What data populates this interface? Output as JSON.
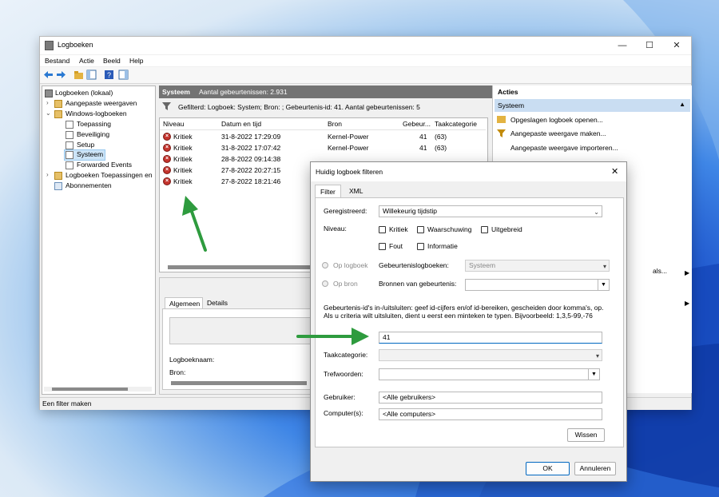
{
  "window": {
    "title": "Logboeken",
    "controls": {
      "minimize": "—",
      "maximize": "☐",
      "close": "✕"
    }
  },
  "menu": [
    "Bestand",
    "Actie",
    "Beeld",
    "Help"
  ],
  "tree": {
    "items": [
      {
        "label": "Logboeken (lokaal)"
      },
      {
        "label": "Aangepaste weergaven"
      },
      {
        "label": "Windows-logboeken"
      },
      {
        "label": "Toepassing"
      },
      {
        "label": "Beveiliging"
      },
      {
        "label": "Setup"
      },
      {
        "label": "Systeem"
      },
      {
        "label": "Forwarded Events"
      },
      {
        "label": "Logboeken Toepassingen en"
      },
      {
        "label": "Abonnementen"
      }
    ]
  },
  "center": {
    "log_name": "Systeem",
    "event_count": "Aantal gebeurtenissen: 2.931",
    "filter_text": "Gefilterd: Logboek: System; Bron: ; Gebeurtenis-id: 41. Aantal gebeurtenissen: 5"
  },
  "events": {
    "columns": [
      "Niveau",
      "Datum en tijd",
      "Bron",
      "Gebeur...",
      "Taakcategorie"
    ],
    "rows": [
      {
        "level": "Kritiek",
        "datetime": "31-8-2022 17:29:09",
        "source": "Kernel-Power",
        "id": "41",
        "category": "(63)"
      },
      {
        "level": "Kritiek",
        "datetime": "31-8-2022 17:07:42",
        "source": "Kernel-Power",
        "id": "41",
        "category": "(63)"
      },
      {
        "level": "Kritiek",
        "datetime": "28-8-2022 09:14:38",
        "source": "",
        "id": "",
        "category": ""
      },
      {
        "level": "Kritiek",
        "datetime": "27-8-2022 20:27:15",
        "source": "",
        "id": "",
        "category": ""
      },
      {
        "level": "Kritiek",
        "datetime": "27-8-2022 18:21:46",
        "source": "",
        "id": "",
        "category": ""
      }
    ]
  },
  "details": {
    "tabs": [
      "Algemeen",
      "Details"
    ],
    "log_name_label": "Logboeknaam:",
    "source_label": "Bron:"
  },
  "actions": {
    "header": "Acties",
    "section": "Systeem",
    "items": [
      "Opgeslagen logboek openen...",
      "Aangepaste weergave maken...",
      "Aangepaste weergave importeren...",
      "als..."
    ]
  },
  "status": {
    "text": "Een filter maken"
  },
  "dialog": {
    "title": "Huidig logboek filteren",
    "tabs": [
      "Filter",
      "XML"
    ],
    "logged_label": "Geregistreerd:",
    "logged_value": "Willekeurig tijdstip",
    "level_label": "Niveau:",
    "levels": [
      "Kritiek",
      "Waarschuwing",
      "Uitgebreid",
      "Fout",
      "Informatie"
    ],
    "by_log_label": "Op logboek",
    "by_source_label": "Op bron",
    "event_logs_label": "Gebeurtenislogboeken:",
    "event_logs_value": "Systeem",
    "event_sources_label": "Bronnen van gebeurtenis:",
    "ids_help": "Gebeurtenis-id's in-/uitsluiten: geef id-cijfers en/of id-bereiken, gescheiden door komma's, op. Als u criteria wilt uitsluiten, dient u eerst een minteken te typen. Bijvoorbeeld: 1,3,5-99,-76",
    "ids_value": "41",
    "task_category_label": "Taakcategorie:",
    "keywords_label": "Trefwoorden:",
    "user_label": "Gebruiker:",
    "user_value": "<Alle gebruikers>",
    "computer_label": "Computer(s):",
    "computer_value": "<Alle computers>",
    "clear_button": "Wissen",
    "ok_button": "OK",
    "cancel_button": "Annuleren",
    "close_glyph": "✕"
  },
  "colors": {
    "accent": "#0067c0",
    "arrow": "#2e9b3e",
    "critical": "#c4342d",
    "header_dark": "#737373",
    "selection": "#cce4f7"
  }
}
